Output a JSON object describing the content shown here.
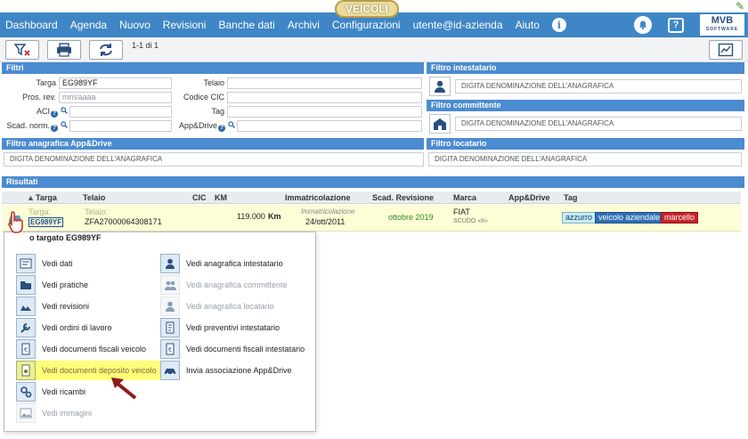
{
  "brand": {
    "module_badge": "VEICOLI"
  },
  "nav": {
    "items": [
      "Dashboard",
      "Agenda",
      "Nuovo",
      "Revisioni",
      "Banche dati",
      "Archivi",
      "Configurazioni",
      "utente@id-azienda",
      "Aiuto"
    ],
    "info": "i",
    "logo_top": "MVB",
    "logo_bottom": "SOFTWARE"
  },
  "toolbar": {
    "count": "1-1 di 1"
  },
  "filtri": {
    "title": "Filtri",
    "targa_label": "Targa",
    "targa_value": "EG989YF",
    "prosrev_label": "Pros. rev.",
    "prosrev_placeholder": "mm/aaaa",
    "aci_label": "ACI",
    "scad_label": "Scad. norm.",
    "telaio_label": "Telaio",
    "cic_label": "Codice CIC",
    "tag_label": "Tag",
    "appdrive_label": "App&Drive",
    "help": "?"
  },
  "intestatario": {
    "title": "Filtro intestatario",
    "placeholder": "DIGITA DENOMINAZIONE DELL'ANAGRAFICA"
  },
  "committente": {
    "title": "Filtro committente",
    "placeholder": "DIGITA DENOMINAZIONE DELL'ANAGRAFICA"
  },
  "appdrive_filter": {
    "title": "Filtro anagrafica App&Drive",
    "placeholder": "DIGITA DENOMINAZIONE DELL'ANAGRAFICA"
  },
  "locatario": {
    "title": "Filtro locatario",
    "placeholder": "DIGITA DENOMINAZIONE DELL'ANAGRAFICA"
  },
  "results": {
    "title": "Risultati",
    "columns": {
      "targa": "Targa",
      "telaio": "Telaio",
      "cic": "CIC",
      "km": "KM",
      "immatricolazione": "Immatricolazione",
      "scad": "Scad. Revisione",
      "marca": "Marca",
      "appdrive": "App&Drive",
      "tag": "Tag"
    },
    "sort_arrow": "▲",
    "row": {
      "targa_label": "Targa:",
      "targa": "EG989YF",
      "telaio_label": "Telaio:",
      "telaio": "ZFA27000064308171",
      "km": "119.000",
      "km_unit": "Km",
      "imm_label": "Immatricolazione",
      "imm_date": "24/ott/2011",
      "scad": "ottobre 2019",
      "marca": "FIAT",
      "modello": "SCUDO «II»",
      "tags": [
        "azzurro",
        "veicolo aziendale",
        "marcello"
      ]
    }
  },
  "menu": {
    "title": "o targato EG989YF",
    "left": [
      {
        "label": "Vedi dati",
        "disabled": false
      },
      {
        "label": "Vedi pratiche",
        "disabled": false
      },
      {
        "label": "Vedi revisioni",
        "disabled": false
      },
      {
        "label": "Vedi ordini di lavoro",
        "disabled": false
      },
      {
        "label": "Vedi documenti fiscali veicolo",
        "disabled": false
      },
      {
        "label": "Vedi documenti deposito veicolo",
        "disabled": false
      },
      {
        "label": "Vedi ricambi",
        "disabled": false
      },
      {
        "label": "Vedi immagini",
        "disabled": true
      }
    ],
    "right": [
      {
        "label": "Vedi anagrafica intestatario",
        "disabled": false
      },
      {
        "label": "Vedi anagrafica committente",
        "disabled": true
      },
      {
        "label": "Vedi anagrafica locatario",
        "disabled": true
      },
      {
        "label": "Vedi preventivi intestatario",
        "disabled": false
      },
      {
        "label": "Vedi documenti fiscali intestatario",
        "disabled": false
      },
      {
        "label": "Invia associazione App&Drive",
        "disabled": false
      }
    ]
  },
  "colors": {
    "nav": "#3f86c6",
    "panel_header": "#4b8bd0",
    "row_highlight": "#fdfdd6",
    "menu_highlight": "#ffff7a"
  }
}
